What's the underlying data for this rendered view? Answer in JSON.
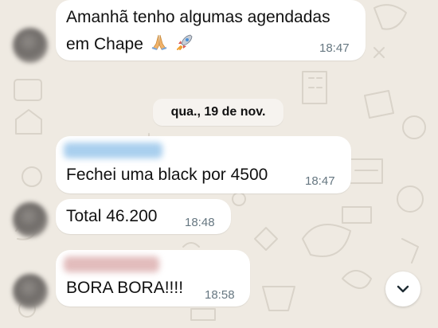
{
  "chat": {
    "messages": [
      {
        "text_line1": "Amanhã tenho algumas agendadas",
        "text_line2": "em Chape",
        "emoji": [
          "pray-icon",
          "rocket-icon"
        ],
        "time": "18:47"
      },
      {
        "text": "Fechei uma black por 4500",
        "time": "18:47",
        "sender_color": "#3fa7e0"
      },
      {
        "text": "Total 46.200",
        "time": "18:48"
      },
      {
        "text": "BORA BORA!!!!",
        "time": "18:58",
        "sender_color": "#c98a8a"
      }
    ]
  },
  "date_separator": "qua., 19 de nov.",
  "scroll_button": {
    "icon": "chevron-down-icon"
  },
  "colors": {
    "wallpaper": "#efeae2",
    "bubble": "#ffffff",
    "timestamp": "#667781"
  }
}
